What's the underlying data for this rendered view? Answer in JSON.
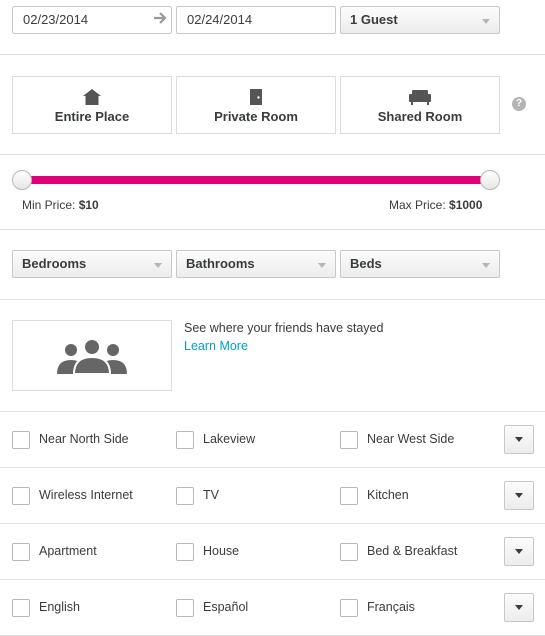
{
  "dates": {
    "checkin": "02/23/2014",
    "checkout": "02/24/2014",
    "arrow_icon": "arrow-right-icon"
  },
  "guests": {
    "selected": "1 Guest"
  },
  "room_types": [
    {
      "label": "Entire Place",
      "icon": "house-icon"
    },
    {
      "label": "Private Room",
      "icon": "door-icon"
    },
    {
      "label": "Shared Room",
      "icon": "couch-icon"
    }
  ],
  "help": {
    "glyph": "?"
  },
  "price": {
    "min_label": "Min Price:",
    "min_value": "$10",
    "max_label": "Max Price:",
    "max_value": "$1000",
    "track_color": "#e0007a"
  },
  "size_filters": {
    "bedrooms": "Bedrooms",
    "bathrooms": "Bathrooms",
    "beds": "Beds"
  },
  "friends": {
    "text": "See where your friends have stayed",
    "link": "Learn More",
    "link_color": "#00a1c9"
  },
  "filter_rows": [
    {
      "items": [
        "Near North Side",
        "Lakeview",
        "Near West Side"
      ]
    },
    {
      "items": [
        "Wireless Internet",
        "TV",
        "Kitchen"
      ]
    },
    {
      "items": [
        "Apartment",
        "House",
        "Bed & Breakfast"
      ]
    },
    {
      "items": [
        "English",
        "Español",
        "Français"
      ]
    }
  ]
}
